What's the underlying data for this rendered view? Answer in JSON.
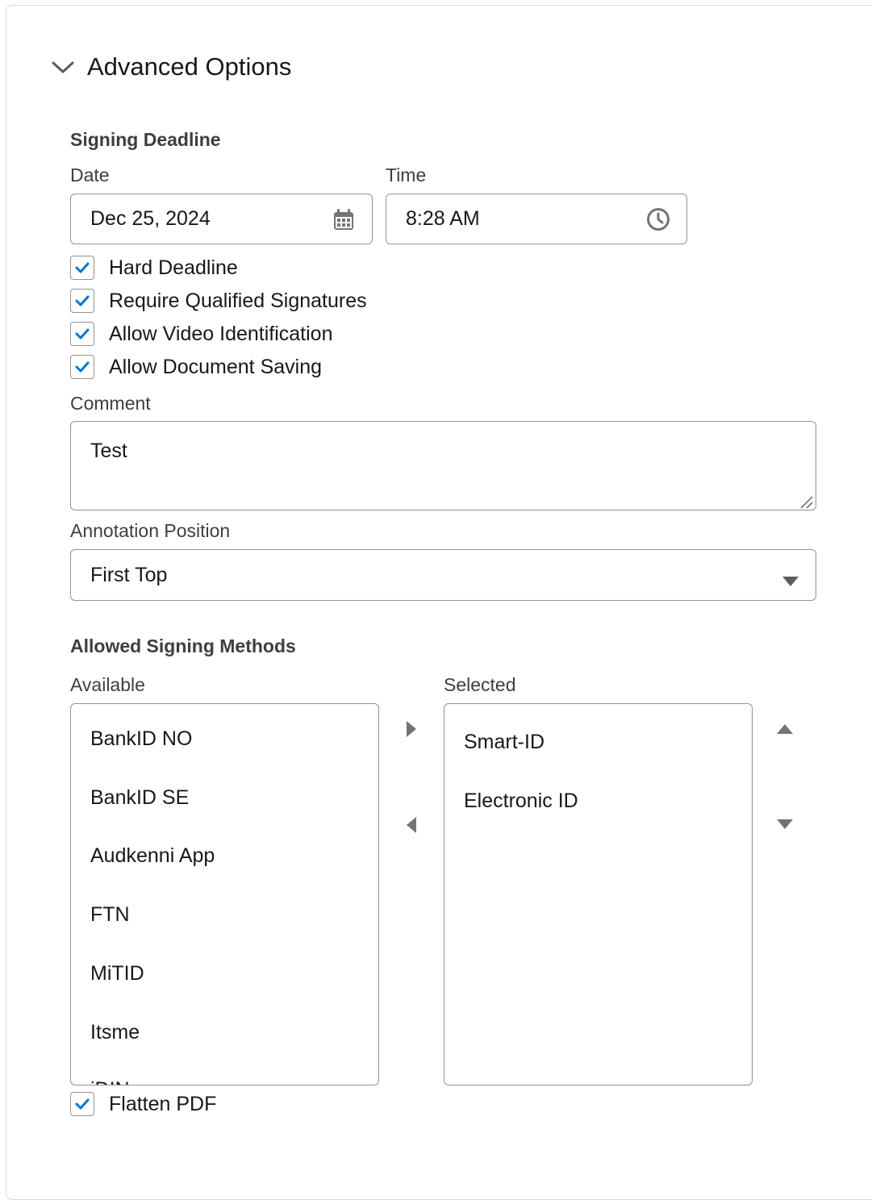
{
  "section": {
    "title": "Advanced Options",
    "toggle_icon": "chevron-down-icon"
  },
  "signing_deadline": {
    "heading": "Signing Deadline",
    "date_label": "Date",
    "date_value": "Dec 25, 2024",
    "date_icon": "calendar-icon",
    "time_label": "Time",
    "time_value": "8:28 AM",
    "time_icon": "clock-icon"
  },
  "checkboxes": [
    {
      "label": "Hard Deadline",
      "checked": true
    },
    {
      "label": "Require Qualified Signatures",
      "checked": true
    },
    {
      "label": "Allow Video Identification",
      "checked": true
    },
    {
      "label": "Allow Document Saving",
      "checked": true
    }
  ],
  "comment": {
    "label": "Comment",
    "value": "Test"
  },
  "annotation_position": {
    "label": "Annotation Position",
    "selected": "First Top"
  },
  "signing_methods": {
    "heading": "Allowed Signing Methods",
    "available_label": "Available",
    "selected_label": "Selected",
    "available": [
      "BankID NO",
      "BankID SE",
      "Audkenni App",
      "FTN",
      "MiTID",
      "Itsme",
      "iDIN"
    ],
    "selected": [
      "Smart-ID",
      "Electronic ID"
    ]
  },
  "flatten_pdf": {
    "label": "Flatten PDF",
    "checked": true
  },
  "colors": {
    "accent": "#0176d3",
    "border": "#939393",
    "icon_gray": "#747474"
  }
}
